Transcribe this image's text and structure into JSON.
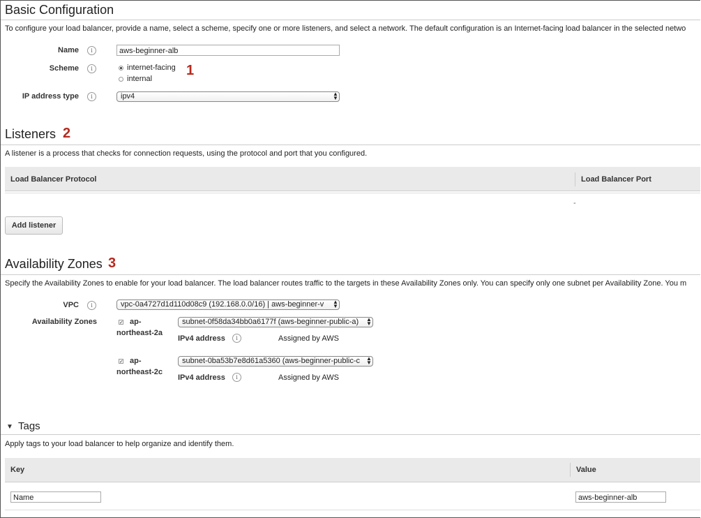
{
  "basic": {
    "title": "Basic Configuration",
    "description": "To configure your load balancer, provide a name, select a scheme, specify one or more listeners, and select a network. The default configuration is an Internet-facing load balancer in the selected netwo",
    "name_label": "Name",
    "name_value": "aws-beginner-alb",
    "scheme_label": "Scheme",
    "scheme_options": [
      "internet-facing",
      "internal"
    ],
    "scheme_selected": "internet-facing",
    "ip_label": "IP address type",
    "ip_value": "ipv4",
    "marker": "1"
  },
  "listeners": {
    "title": "Listeners",
    "marker": "2",
    "description": "A listener is a process that checks for connection requests, using the protocol and port that you configured.",
    "col_protocol": "Load Balancer Protocol",
    "col_port": "Load Balancer Port",
    "dash": "-",
    "add_button": "Add listener"
  },
  "az": {
    "title": "Availability Zones",
    "marker": "3",
    "description": "Specify the Availability Zones to enable for your load balancer. The load balancer routes traffic to the targets in these Availability Zones only. You can specify only one subnet per Availability Zone. You m",
    "vpc_label": "VPC",
    "vpc_value": "vpc-0a4727d1d110d08c9 (192.168.0.0/16) | aws-beginner-v",
    "zones_label": "Availability Zones",
    "zones": [
      {
        "name_line1": "ap-",
        "name_line2": "northeast-2a",
        "subnet": "subnet-0f58da34bb0a6177f (aws-beginner-public-a)",
        "ipv4_label": "IPv4 address",
        "ipv4_value": "Assigned by AWS",
        "checked": true
      },
      {
        "name_line1": "ap-",
        "name_line2": "northeast-2c",
        "subnet": "subnet-0ba53b7e8d61a5360 (aws-beginner-public-c",
        "ipv4_label": "IPv4 address",
        "ipv4_value": "Assigned by AWS",
        "checked": true
      }
    ]
  },
  "tags": {
    "title": "Tags",
    "description": "Apply tags to your load balancer to help organize and identify them.",
    "col_key": "Key",
    "col_value": "Value",
    "row_key": "Name",
    "row_value": "aws-beginner-alb"
  },
  "icons": {
    "info": "info-icon",
    "expand": "triangle-down-icon",
    "select_arrow": "updown-arrow-icon"
  }
}
